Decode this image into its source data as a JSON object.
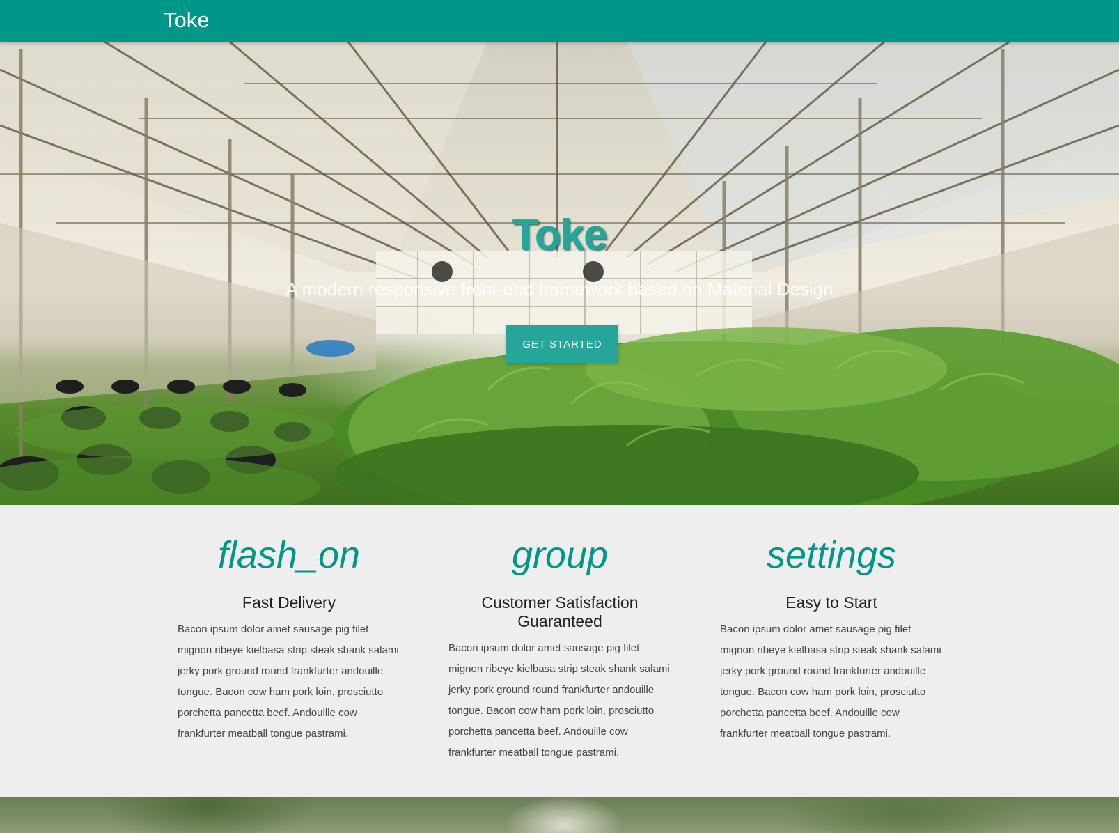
{
  "navbar": {
    "brand": "Toke",
    "color": "#009688"
  },
  "hero": {
    "title": "Toke",
    "subtitle": "A modern responsive front-end framework based on Material Design",
    "button_label": "Get Started",
    "accent": "#26a69a"
  },
  "features": [
    {
      "icon_name": "flash_on",
      "title": "Fast Delivery",
      "text": "Bacon ipsum dolor amet sausage pig filet mignon ribeye kielbasa strip steak shank salami jerky pork ground round frankfurter andouille tongue. Bacon cow ham pork loin, prosciutto porchetta pancetta beef. Andouille cow frankfurter meatball tongue pastrami."
    },
    {
      "icon_name": "group",
      "title": "Customer Satisfaction Guaranteed",
      "text": "Bacon ipsum dolor amet sausage pig filet mignon ribeye kielbasa strip steak shank salami jerky pork ground round frankfurter andouille tongue. Bacon cow ham pork loin, prosciutto porchetta pancetta beef. Andouille cow frankfurter meatball tongue pastrami."
    },
    {
      "icon_name": "settings",
      "title": "Easy to Start",
      "text": "Bacon ipsum dolor amet sausage pig filet mignon ribeye kielbasa strip steak shank salami jerky pork ground round frankfurter andouille tongue. Bacon cow ham pork loin, prosciutto porchetta pancetta beef. Andouille cow frankfurter meatball tongue pastrami."
    }
  ]
}
